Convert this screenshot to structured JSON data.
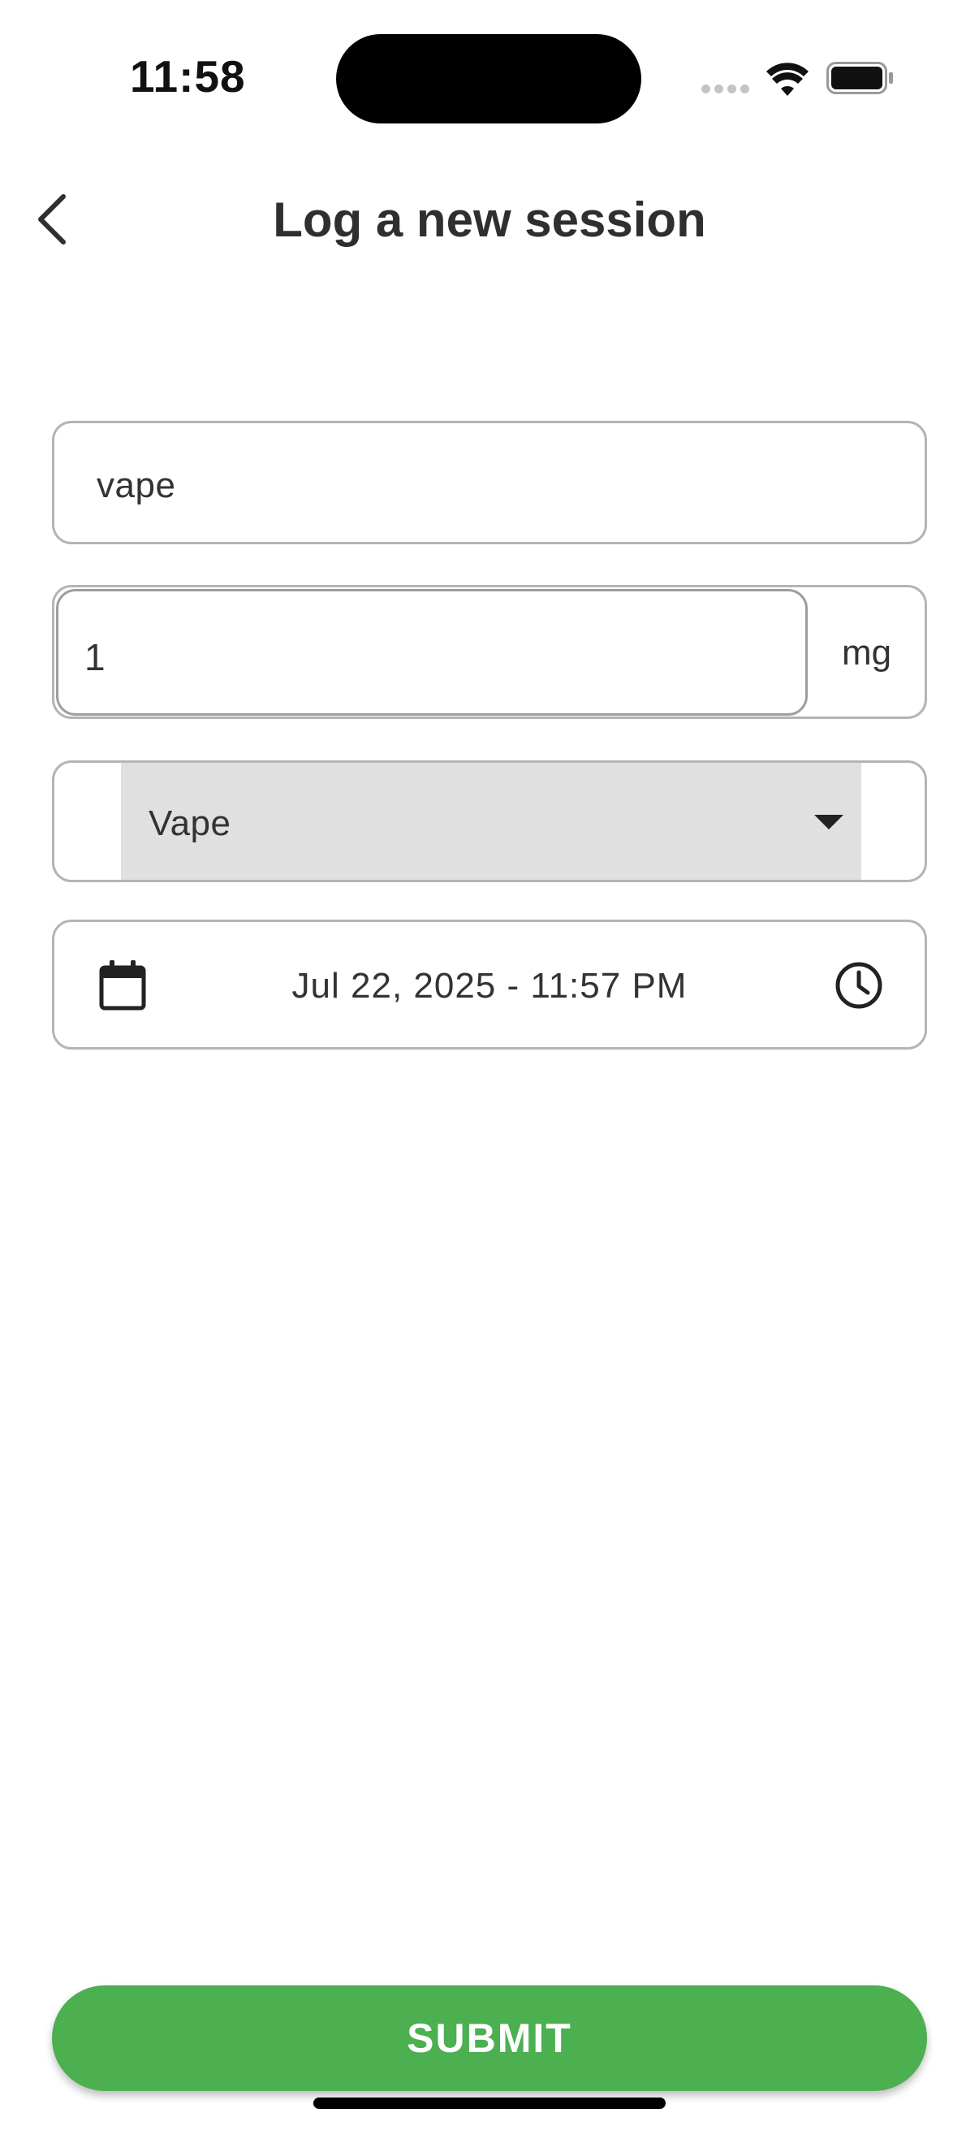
{
  "status_bar": {
    "time": "11:58"
  },
  "header": {
    "title": "Log a new session"
  },
  "form": {
    "name_value": "vape",
    "dose_value": "1",
    "dose_unit": "mg",
    "type_value": "Vape",
    "datetime_value": "Jul 22, 2025 - 11:57 PM"
  },
  "submit_label": "SUBMIT",
  "icons": [
    "back-chevron-icon",
    "calendar-icon",
    "clock-icon",
    "chevron-down-icon",
    "wifi-icon",
    "battery-icon",
    "cellular-signal-icon"
  ],
  "colors": {
    "accent": "#4caf50",
    "field_border": "#b4b4b4",
    "select_fill": "#e0e0e0",
    "text": "#2f2f2f"
  }
}
